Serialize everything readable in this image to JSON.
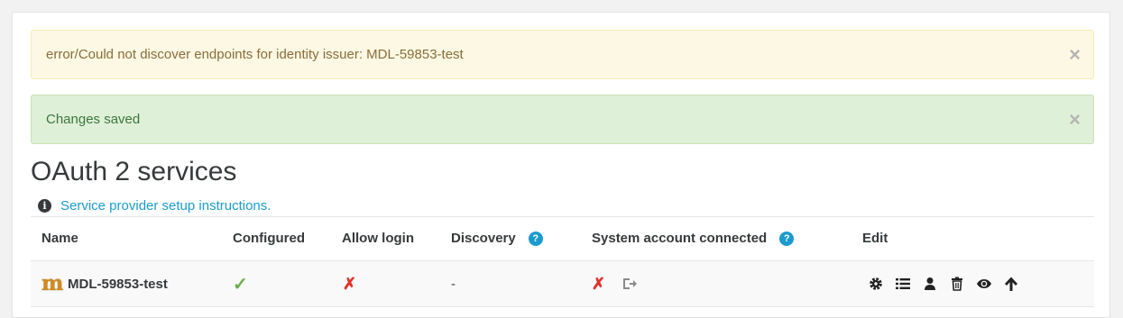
{
  "alerts": {
    "warning": {
      "message": "error/Could not discover endpoints for identity issuer: MDL-59853-test",
      "close": "×"
    },
    "success": {
      "message": "Changes saved",
      "close": "×"
    }
  },
  "page": {
    "title": "OAuth 2 services",
    "info_icon": "info-circle-icon",
    "setup_link": "Service provider setup instructions."
  },
  "table": {
    "headers": {
      "name": "Name",
      "configured": "Configured",
      "allow_login": "Allow login",
      "discovery": "Discovery",
      "system_account": "System account connected",
      "edit": "Edit"
    },
    "help_icon": "?",
    "rows": [
      {
        "name": "MDL-59853-test",
        "logo": "m",
        "configured": "✓",
        "allow_login": "✗",
        "discovery": "-",
        "system_account": "✗",
        "actions": [
          "gear-icon",
          "list-icon",
          "user-icon",
          "trash-icon",
          "eye-icon",
          "arrow-up-icon"
        ]
      }
    ]
  },
  "colors": {
    "link": "#1a9bce",
    "success_check": "#6ab04c",
    "error_cross": "#e0332a"
  }
}
